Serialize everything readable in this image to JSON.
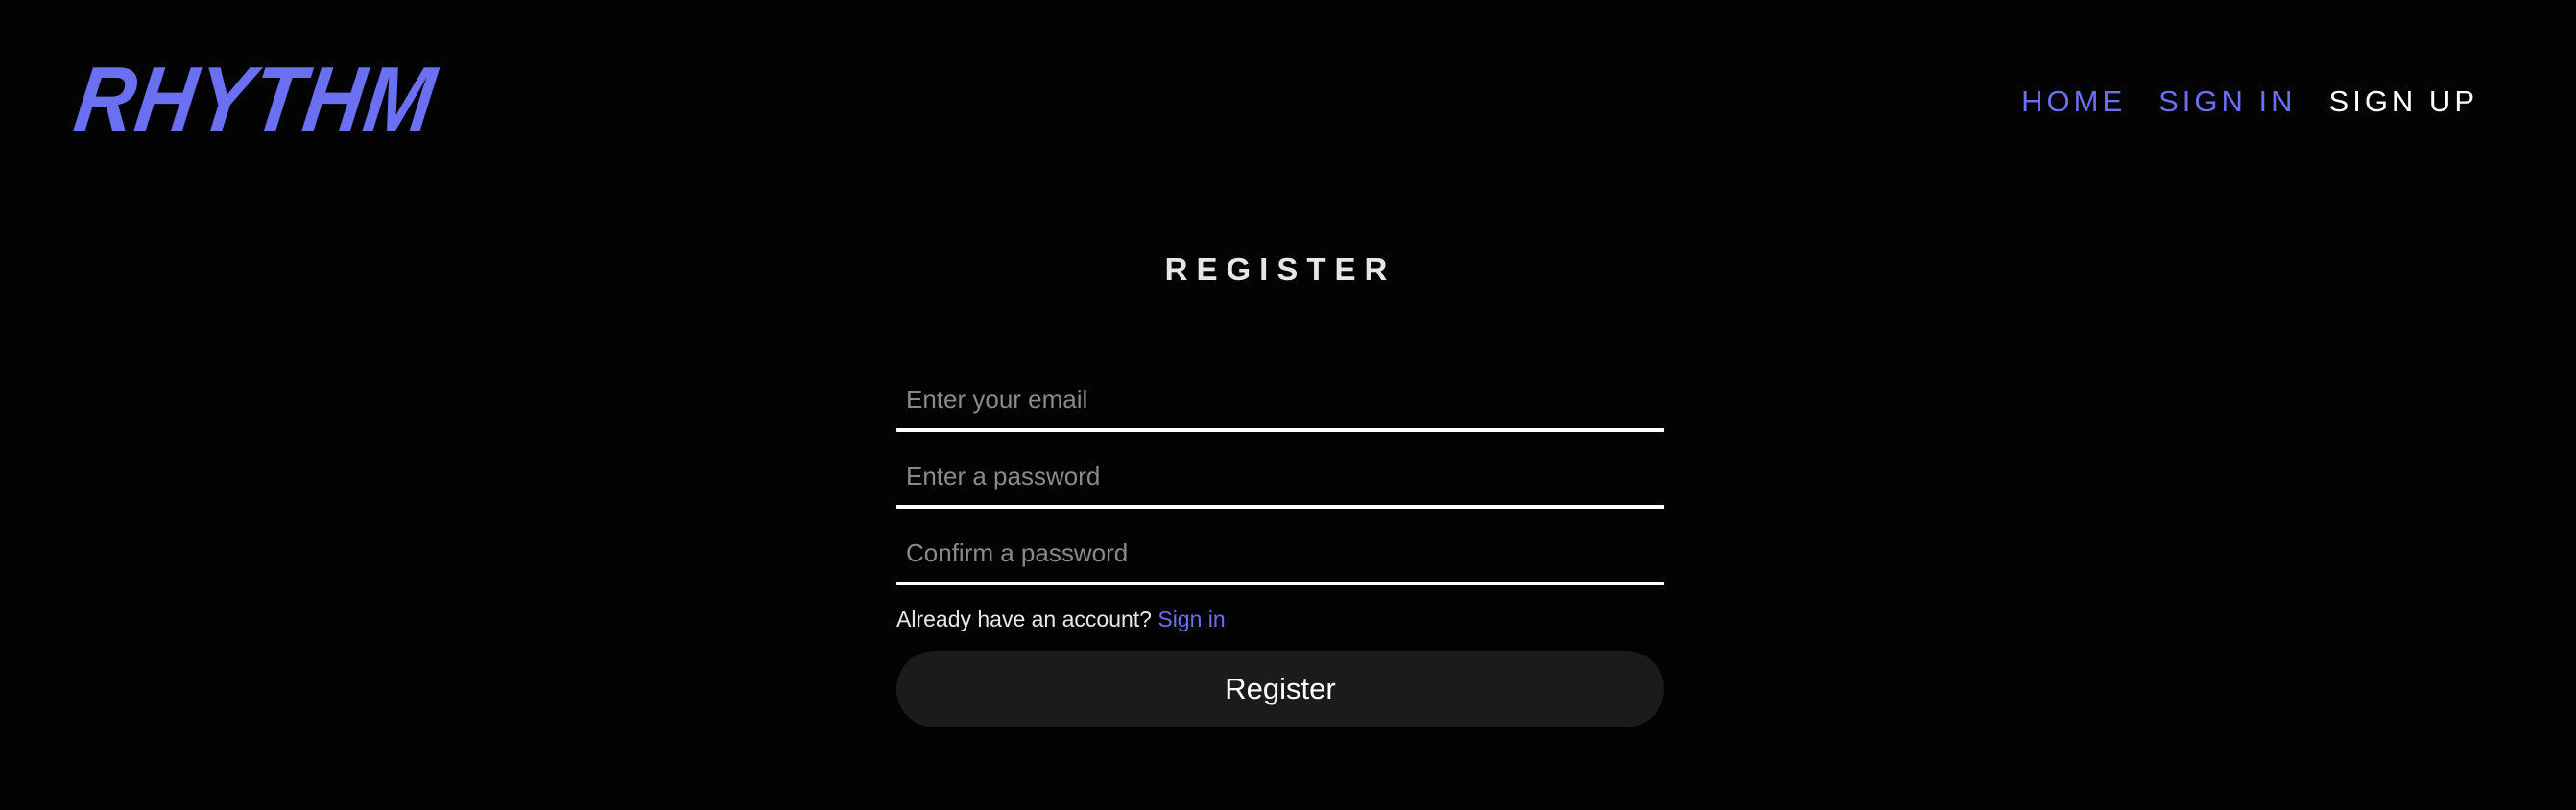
{
  "header": {
    "logo": "RHYTHM",
    "nav": {
      "home": "HOME",
      "sign_in": "SIGN IN",
      "sign_up": "SIGN UP"
    }
  },
  "register": {
    "title": "REGISTER",
    "email": {
      "value": "",
      "placeholder": "Enter your email"
    },
    "password": {
      "value": "",
      "placeholder": "Enter a password"
    },
    "confirm": {
      "value": "",
      "placeholder": "Confirm a password"
    },
    "already_text": "Already have an account?",
    "sign_in_link": "Sign in",
    "button_label": "Register"
  },
  "colors": {
    "background": "#030303",
    "accent": "#6b6ff2",
    "button_bg": "#1b1b1b",
    "text": "#ffffff"
  }
}
